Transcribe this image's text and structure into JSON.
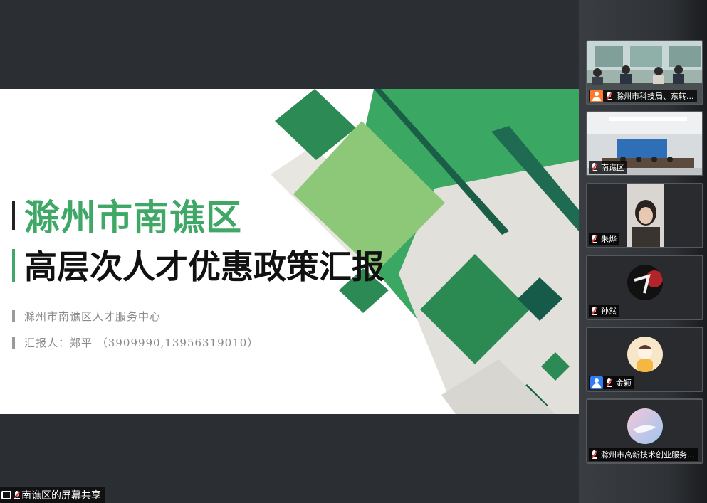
{
  "slide": {
    "title": "滁州市南谯区",
    "subtitle": "高层次人才优惠政策汇报",
    "organization": "滁州市南谯区人才服务中心",
    "reporter": "汇报人：郑平    （3909990,13956319010）",
    "accent_color": "#3fa866"
  },
  "share": {
    "label": "南谯区的屏幕共享",
    "icon": "screen-share-icon"
  },
  "participants": [
    {
      "name": "滁州市科技局、东转...",
      "muted": true,
      "badge": "orange-avatar-icon",
      "video": "meeting-room"
    },
    {
      "name": "南谯区",
      "muted": true,
      "video": "conference-hall"
    },
    {
      "name": "朱烨",
      "muted": true,
      "video": "person-camera"
    },
    {
      "name": "孙然",
      "muted": true,
      "video": "avatar-dark"
    },
    {
      "name": "金颖",
      "muted": true,
      "badge": "blue-avatar-icon",
      "video": "avatar-cartoon"
    },
    {
      "name": "滁州市高新技术创业服务...",
      "muted": true,
      "video": "avatar-sky"
    }
  ]
}
